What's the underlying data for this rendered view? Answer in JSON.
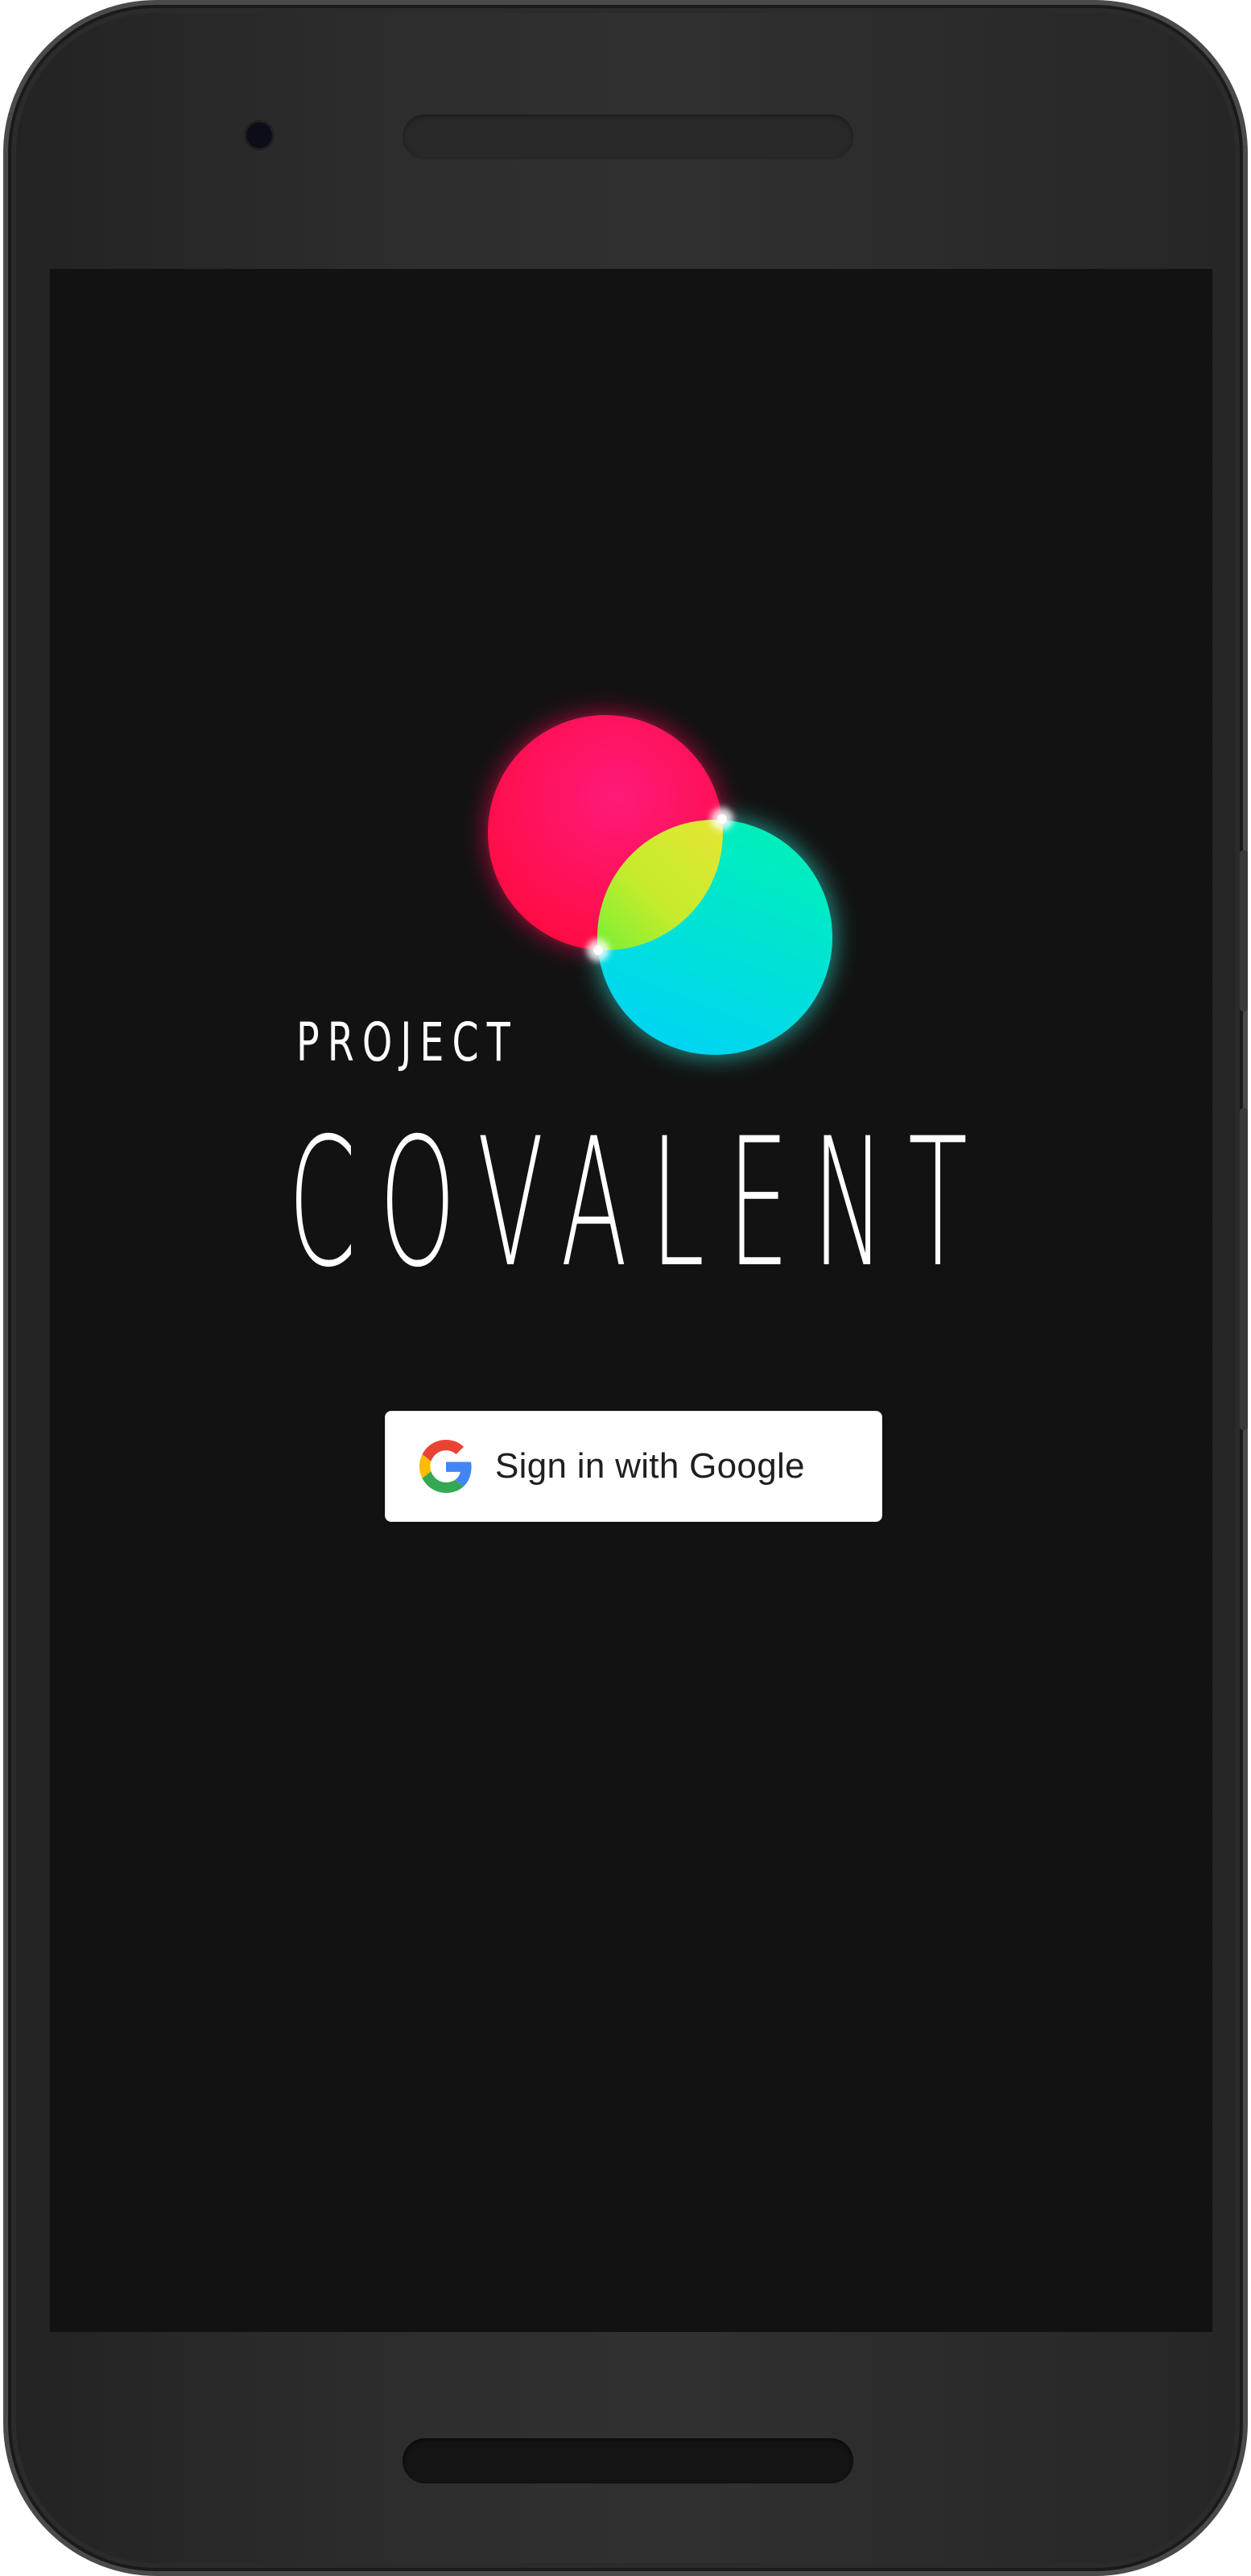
{
  "app": {
    "title_top": "PROJECT",
    "title_main": "COVALENT"
  },
  "sign_in": {
    "label": "Sign in with Google"
  },
  "colors": {
    "screen_background": "#121212",
    "logo_red": "#ff0a4f",
    "logo_cyan": "#00d9f0",
    "logo_overlap_yellow": "#f0ec36",
    "logo_overlap_green": "#3ef23a",
    "button_background": "#ffffff"
  },
  "icons": {
    "logo": "two-overlapping-glowing-circles",
    "sign_in_icon": "google-g-icon"
  }
}
